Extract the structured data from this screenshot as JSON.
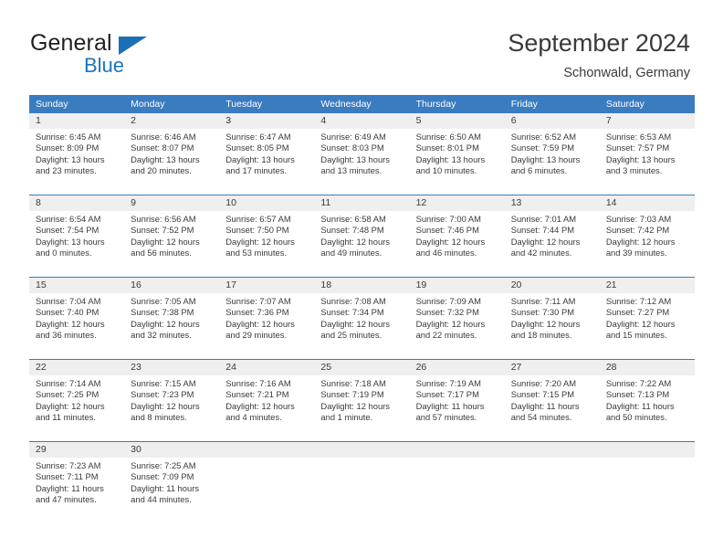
{
  "brand": {
    "word1": "General",
    "word2": "Blue",
    "logo_icon": "blue-triangle-icon",
    "accent_color": "#1b75bb"
  },
  "header": {
    "title": "September 2024",
    "subtitle": "Schonwald, Germany"
  },
  "calendar": {
    "header_bg": "#3a7cc0",
    "day_band_bg": "#efefef",
    "weekdays": [
      "Sunday",
      "Monday",
      "Tuesday",
      "Wednesday",
      "Thursday",
      "Friday",
      "Saturday"
    ],
    "labels": {
      "sunrise": "Sunrise:",
      "sunset": "Sunset:",
      "daylight": "Daylight:"
    },
    "weeks": [
      [
        {
          "day": "1",
          "sunrise": "Sunrise: 6:45 AM",
          "sunset": "Sunset: 8:09 PM",
          "daylight1": "Daylight: 13 hours",
          "daylight2": "and 23 minutes."
        },
        {
          "day": "2",
          "sunrise": "Sunrise: 6:46 AM",
          "sunset": "Sunset: 8:07 PM",
          "daylight1": "Daylight: 13 hours",
          "daylight2": "and 20 minutes."
        },
        {
          "day": "3",
          "sunrise": "Sunrise: 6:47 AM",
          "sunset": "Sunset: 8:05 PM",
          "daylight1": "Daylight: 13 hours",
          "daylight2": "and 17 minutes."
        },
        {
          "day": "4",
          "sunrise": "Sunrise: 6:49 AM",
          "sunset": "Sunset: 8:03 PM",
          "daylight1": "Daylight: 13 hours",
          "daylight2": "and 13 minutes."
        },
        {
          "day": "5",
          "sunrise": "Sunrise: 6:50 AM",
          "sunset": "Sunset: 8:01 PM",
          "daylight1": "Daylight: 13 hours",
          "daylight2": "and 10 minutes."
        },
        {
          "day": "6",
          "sunrise": "Sunrise: 6:52 AM",
          "sunset": "Sunset: 7:59 PM",
          "daylight1": "Daylight: 13 hours",
          "daylight2": "and 6 minutes."
        },
        {
          "day": "7",
          "sunrise": "Sunrise: 6:53 AM",
          "sunset": "Sunset: 7:57 PM",
          "daylight1": "Daylight: 13 hours",
          "daylight2": "and 3 minutes."
        }
      ],
      [
        {
          "day": "8",
          "sunrise": "Sunrise: 6:54 AM",
          "sunset": "Sunset: 7:54 PM",
          "daylight1": "Daylight: 13 hours",
          "daylight2": "and 0 minutes."
        },
        {
          "day": "9",
          "sunrise": "Sunrise: 6:56 AM",
          "sunset": "Sunset: 7:52 PM",
          "daylight1": "Daylight: 12 hours",
          "daylight2": "and 56 minutes."
        },
        {
          "day": "10",
          "sunrise": "Sunrise: 6:57 AM",
          "sunset": "Sunset: 7:50 PM",
          "daylight1": "Daylight: 12 hours",
          "daylight2": "and 53 minutes."
        },
        {
          "day": "11",
          "sunrise": "Sunrise: 6:58 AM",
          "sunset": "Sunset: 7:48 PM",
          "daylight1": "Daylight: 12 hours",
          "daylight2": "and 49 minutes."
        },
        {
          "day": "12",
          "sunrise": "Sunrise: 7:00 AM",
          "sunset": "Sunset: 7:46 PM",
          "daylight1": "Daylight: 12 hours",
          "daylight2": "and 46 minutes."
        },
        {
          "day": "13",
          "sunrise": "Sunrise: 7:01 AM",
          "sunset": "Sunset: 7:44 PM",
          "daylight1": "Daylight: 12 hours",
          "daylight2": "and 42 minutes."
        },
        {
          "day": "14",
          "sunrise": "Sunrise: 7:03 AM",
          "sunset": "Sunset: 7:42 PM",
          "daylight1": "Daylight: 12 hours",
          "daylight2": "and 39 minutes."
        }
      ],
      [
        {
          "day": "15",
          "sunrise": "Sunrise: 7:04 AM",
          "sunset": "Sunset: 7:40 PM",
          "daylight1": "Daylight: 12 hours",
          "daylight2": "and 36 minutes."
        },
        {
          "day": "16",
          "sunrise": "Sunrise: 7:05 AM",
          "sunset": "Sunset: 7:38 PM",
          "daylight1": "Daylight: 12 hours",
          "daylight2": "and 32 minutes."
        },
        {
          "day": "17",
          "sunrise": "Sunrise: 7:07 AM",
          "sunset": "Sunset: 7:36 PM",
          "daylight1": "Daylight: 12 hours",
          "daylight2": "and 29 minutes."
        },
        {
          "day": "18",
          "sunrise": "Sunrise: 7:08 AM",
          "sunset": "Sunset: 7:34 PM",
          "daylight1": "Daylight: 12 hours",
          "daylight2": "and 25 minutes."
        },
        {
          "day": "19",
          "sunrise": "Sunrise: 7:09 AM",
          "sunset": "Sunset: 7:32 PM",
          "daylight1": "Daylight: 12 hours",
          "daylight2": "and 22 minutes."
        },
        {
          "day": "20",
          "sunrise": "Sunrise: 7:11 AM",
          "sunset": "Sunset: 7:30 PM",
          "daylight1": "Daylight: 12 hours",
          "daylight2": "and 18 minutes."
        },
        {
          "day": "21",
          "sunrise": "Sunrise: 7:12 AM",
          "sunset": "Sunset: 7:27 PM",
          "daylight1": "Daylight: 12 hours",
          "daylight2": "and 15 minutes."
        }
      ],
      [
        {
          "day": "22",
          "sunrise": "Sunrise: 7:14 AM",
          "sunset": "Sunset: 7:25 PM",
          "daylight1": "Daylight: 12 hours",
          "daylight2": "and 11 minutes."
        },
        {
          "day": "23",
          "sunrise": "Sunrise: 7:15 AM",
          "sunset": "Sunset: 7:23 PM",
          "daylight1": "Daylight: 12 hours",
          "daylight2": "and 8 minutes."
        },
        {
          "day": "24",
          "sunrise": "Sunrise: 7:16 AM",
          "sunset": "Sunset: 7:21 PM",
          "daylight1": "Daylight: 12 hours",
          "daylight2": "and 4 minutes."
        },
        {
          "day": "25",
          "sunrise": "Sunrise: 7:18 AM",
          "sunset": "Sunset: 7:19 PM",
          "daylight1": "Daylight: 12 hours",
          "daylight2": "and 1 minute."
        },
        {
          "day": "26",
          "sunrise": "Sunrise: 7:19 AM",
          "sunset": "Sunset: 7:17 PM",
          "daylight1": "Daylight: 11 hours",
          "daylight2": "and 57 minutes."
        },
        {
          "day": "27",
          "sunrise": "Sunrise: 7:20 AM",
          "sunset": "Sunset: 7:15 PM",
          "daylight1": "Daylight: 11 hours",
          "daylight2": "and 54 minutes."
        },
        {
          "day": "28",
          "sunrise": "Sunrise: 7:22 AM",
          "sunset": "Sunset: 7:13 PM",
          "daylight1": "Daylight: 11 hours",
          "daylight2": "and 50 minutes."
        }
      ],
      [
        {
          "day": "29",
          "sunrise": "Sunrise: 7:23 AM",
          "sunset": "Sunset: 7:11 PM",
          "daylight1": "Daylight: 11 hours",
          "daylight2": "and 47 minutes."
        },
        {
          "day": "30",
          "sunrise": "Sunrise: 7:25 AM",
          "sunset": "Sunset: 7:09 PM",
          "daylight1": "Daylight: 11 hours",
          "daylight2": "and 44 minutes."
        },
        {
          "day": "",
          "sunrise": "",
          "sunset": "",
          "daylight1": "",
          "daylight2": ""
        },
        {
          "day": "",
          "sunrise": "",
          "sunset": "",
          "daylight1": "",
          "daylight2": ""
        },
        {
          "day": "",
          "sunrise": "",
          "sunset": "",
          "daylight1": "",
          "daylight2": ""
        },
        {
          "day": "",
          "sunrise": "",
          "sunset": "",
          "daylight1": "",
          "daylight2": ""
        },
        {
          "day": "",
          "sunrise": "",
          "sunset": "",
          "daylight1": "",
          "daylight2": ""
        }
      ]
    ]
  }
}
